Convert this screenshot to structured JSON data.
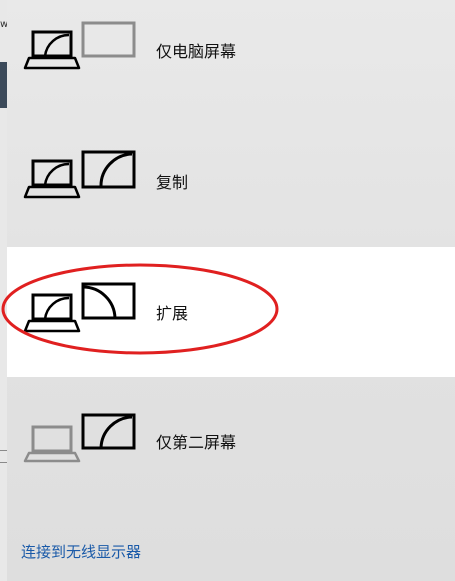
{
  "projection_panel": {
    "options": [
      {
        "label": "仅电脑屏幕",
        "icon": "pc-screen-only-icon",
        "selected": false
      },
      {
        "label": "复制",
        "icon": "duplicate-icon",
        "selected": false
      },
      {
        "label": "扩展",
        "icon": "extend-icon",
        "selected": true
      },
      {
        "label": "仅第二屏幕",
        "icon": "second-screen-only-icon",
        "selected": false
      }
    ],
    "connect_link": "连接到无线显示器"
  },
  "colors": {
    "panel_bg": "#e4e4e4",
    "selected_bg": "#ffffff",
    "link": "#1a5aa8",
    "annotation_ellipse": "#e02020",
    "icon_active": "#000000",
    "icon_inactive": "#8c8c8c"
  }
}
